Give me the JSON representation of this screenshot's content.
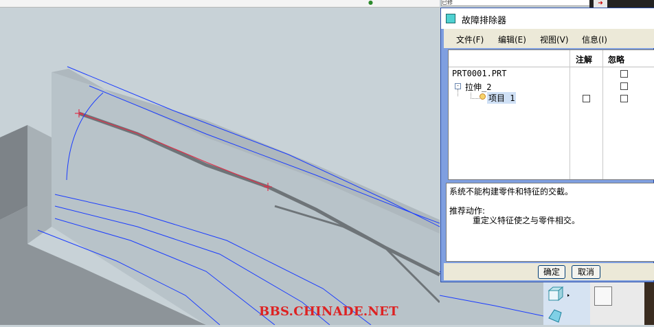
{
  "dialog": {
    "title": "故障排除器",
    "menu": [
      "文件(F)",
      "编辑(E)",
      "视图(V)",
      "信息(I)"
    ],
    "columns": {
      "note": "注解",
      "ignore": "忽略"
    },
    "tree": {
      "root": "PRT0001.PRT",
      "feature": "拉伸_2",
      "item": "项目 1"
    },
    "message": {
      "line1": "系统不能构建零件和特征的交截。",
      "action_label": "推荐动作:",
      "action_text": "重定义特征使之与零件相交。"
    },
    "buttons": {
      "ok": "确定",
      "cancel": "取消"
    }
  },
  "top_field_text": "已修",
  "watermark": "BBS.CHINADE.NET",
  "colors": {
    "dialog_frame": "#7f9fe0",
    "model_surface": "#c9d3d8",
    "curve_blue": "#1a3cff",
    "edge_red": "#e0304a",
    "watermark": "#dd2222"
  }
}
